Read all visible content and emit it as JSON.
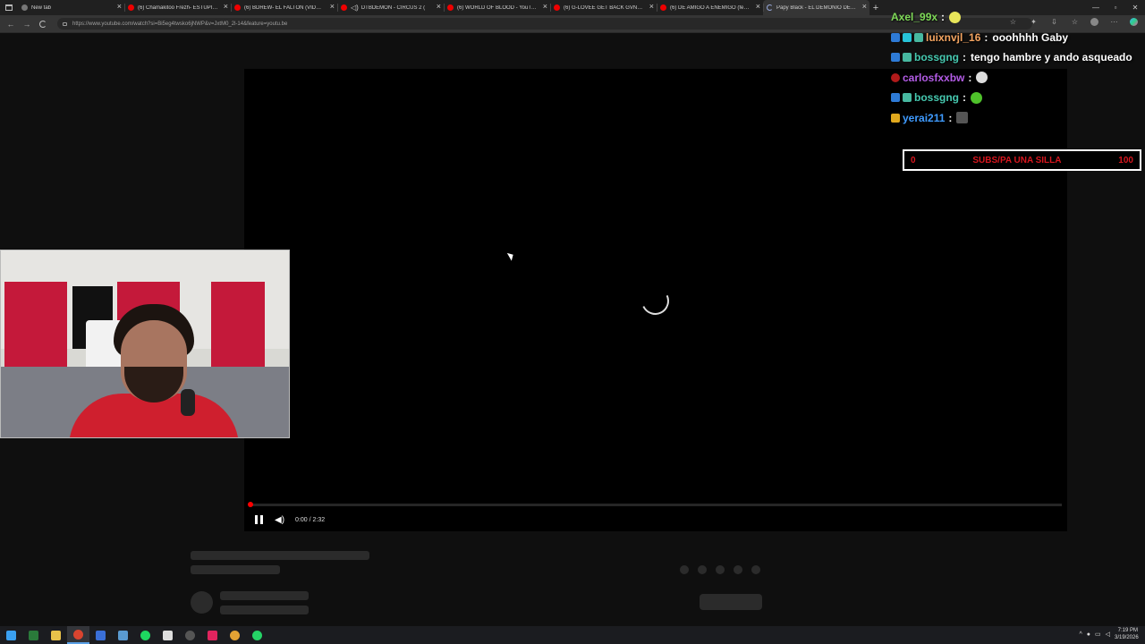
{
  "browser": {
    "tabs": [
      {
        "title": "New tab",
        "icon": "new-tab-icon",
        "active": false
      },
      {
        "title": "(6) Chamakitoo Frezh- ESTUPIDO",
        "icon": "youtube-icon",
        "active": false
      },
      {
        "title": "(6) BDREW- EL FALTON (VIDEO OF",
        "icon": "youtube-icon",
        "active": false
      },
      {
        "title": "DTBDEMON - CIRCUS 2 (",
        "icon": "youtube-icon",
        "active": false,
        "audio": true
      },
      {
        "title": "(6) WORLD OF BLOOD - YouTube",
        "icon": "youtube-icon",
        "active": false
      },
      {
        "title": "(6) G-LOVEE GET BACK GVNG (VI",
        "icon": "youtube-icon",
        "active": false
      },
      {
        "title": "(6) DE AMIGO A ENEMIGO (feat. I",
        "icon": "youtube-icon",
        "active": false
      },
      {
        "title": "Papy Black - EL DEMONIO DEL DI",
        "icon": "loading-icon",
        "active": true
      }
    ],
    "url": "https://www.youtube.com/watch?si=Bi5eg4twsko6jNWP&v=JxtM0_2l-14&feature=youtu.be"
  },
  "player": {
    "time": "0:00 / 2:32",
    "progress": 0.0
  },
  "chat": {
    "messages": [
      {
        "user": "Axel_99x",
        "user_color": "#7ed957",
        "badges": [],
        "text": "",
        "emote": "yellow-face-emote"
      },
      {
        "user": "luixnvjl_16",
        "user_color": "#f4a460",
        "badges": [
          "blue",
          "cyan",
          "teal"
        ],
        "text": "ooohhhh Gaby",
        "emote": ""
      },
      {
        "user": "bossgng",
        "user_color": "#46c9b0",
        "badges": [
          "blue",
          "teal"
        ],
        "text": "tengo hambre y ando asqueado",
        "emote": ""
      },
      {
        "user": "carlosfxxbw",
        "user_color": "#b35ce6",
        "badges": [
          "red"
        ],
        "text": "",
        "emote": "skull-emote"
      },
      {
        "user": "bossgng",
        "user_color": "#46c9b0",
        "badges": [
          "blue",
          "teal"
        ],
        "text": "",
        "emote": "green-emote"
      },
      {
        "user": "yerai211",
        "user_color": "#3f9bff",
        "badges": [
          "gold"
        ],
        "text": "",
        "emote": "mute-emote"
      }
    ],
    "colon": ":"
  },
  "goal": {
    "current": "0",
    "label": "SUBS/PA UNA SILLA",
    "target": "100",
    "color": "#d8161e"
  },
  "taskbar": {
    "time": "7:19 PM",
    "date": "3/19/2026",
    "icons": [
      "windows-start-icon",
      "task-view-icon",
      "file-explorer-icon",
      "chrome-icon",
      "store-icon",
      "steam-icon",
      "spotify-icon",
      "capcut-icon",
      "obs-icon",
      "tiktok-icon",
      "chrome-alt-icon",
      "whatsapp-icon"
    ]
  }
}
